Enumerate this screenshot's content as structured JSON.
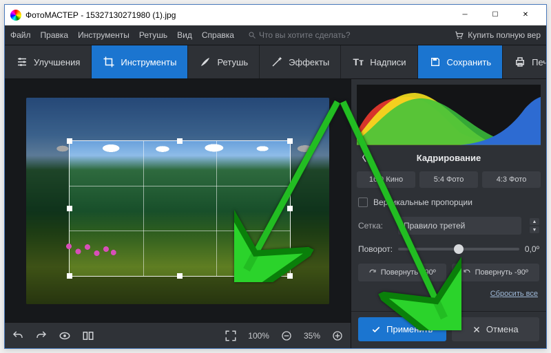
{
  "titlebar": {
    "app": "ФотоМАСТЕР",
    "file": "15327130271980 (1).jpg"
  },
  "menu": {
    "file": "Файл",
    "edit": "Правка",
    "tools": "Инструменты",
    "retouch": "Ретушь",
    "view": "Вид",
    "help": "Справка",
    "search_placeholder": "Что вы хотите сделать?",
    "buy": "Купить полную вер"
  },
  "toolbar": {
    "enhance": "Улучшения",
    "tools": "Инструменты",
    "retouch": "Ретушь",
    "effects": "Эффекты",
    "captions": "Надписи",
    "save": "Сохранить",
    "print": "Печать"
  },
  "bottombar": {
    "fit_pct": "100%",
    "zoom_pct": "35%"
  },
  "side": {
    "panel_title": "Кадрирование",
    "ratio1": "16:9 Кино",
    "ratio2": "5:4 Фото",
    "ratio3": "4:3 Фото",
    "vertical": "Вертикальные пропорции",
    "grid_label": "Сетка:",
    "grid_value": "Правило третей",
    "rotate_label": "Поворот:",
    "rotate_value": "0,0º",
    "rot_plus": "Повернуть +90º",
    "rot_minus": "Повернуть -90º",
    "reset": "Сбросить все",
    "apply": "Применить",
    "cancel": "Отмена"
  }
}
